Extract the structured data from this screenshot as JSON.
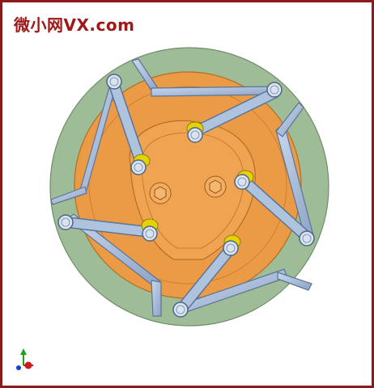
{
  "watermark": {
    "text": "微小网VX.com"
  },
  "colors": {
    "border": "#8b1a1a",
    "outer_ring": "#9ebd97",
    "inner_disc": "#eb9a45",
    "link_fill": "#a9bddb",
    "link_stroke": "#5d7496",
    "pin_fill": "#d8e3ef",
    "yellow_washer": "#e5d200"
  },
  "icons": [
    "xyz-axis-triad-icon"
  ]
}
